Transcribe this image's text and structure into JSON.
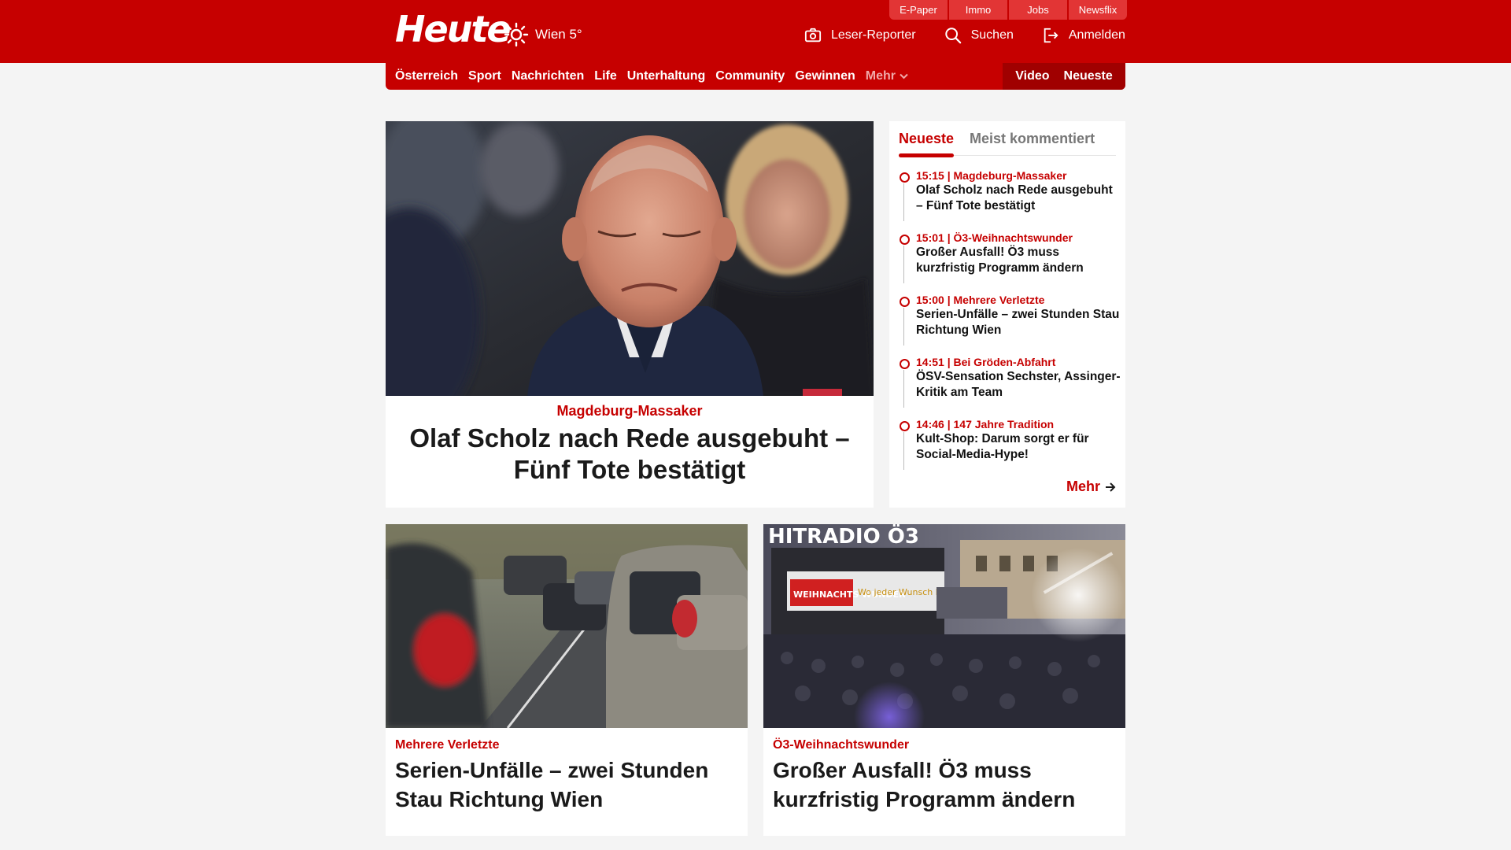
{
  "header": {
    "logo": "Heute",
    "weather": {
      "icon": "sun-icon",
      "text": "Wien 5°"
    },
    "service_tabs": [
      "E-Paper",
      "Immo",
      "Jobs",
      "Newsflix"
    ],
    "actions": [
      {
        "label": "Leser-Reporter",
        "icon": "camera-icon"
      },
      {
        "label": "Suchen",
        "icon": "search-icon"
      },
      {
        "label": "Anmelden",
        "icon": "login-icon"
      }
    ]
  },
  "nav": {
    "items": [
      "Österreich",
      "Sport",
      "Nachrichten",
      "Life",
      "Unterhaltung",
      "Community",
      "Gewinnen"
    ],
    "more": "Mehr",
    "right": [
      "Video",
      "Neueste"
    ]
  },
  "lead": {
    "kicker": "Magdeburg-Massaker",
    "title": "Olaf Scholz nach Rede ausgebuht – Fünf Tote bestätigt"
  },
  "sidebar": {
    "tabs": [
      "Neueste",
      "Meist kommentiert"
    ],
    "items": [
      {
        "meta": "15:15 | Magdeburg-Massaker",
        "title": "Olaf Scholz nach Rede ausgebuht – Fünf Tote bestätigt"
      },
      {
        "meta": "15:01 | Ö3-Weihnachtswunder",
        "title": "Großer Ausfall! Ö3 muss kurzfristig Programm ändern"
      },
      {
        "meta": "15:00 | Mehrere Verletzte",
        "title": "Serien-Unfälle – zwei Stunden Stau Richtung Wien"
      },
      {
        "meta": "14:51 | Bei Gröden-Abfahrt",
        "title": "ÖSV-Sensation Sechster, Assinger-Kritik am Team"
      },
      {
        "meta": "14:46 | 147 Jahre Tradition",
        "title": "Kult-Shop: Darum sorgt er für Social-Media-Hype!"
      }
    ],
    "more": "Mehr"
  },
  "cards": [
    {
      "kicker": "Mehrere Verletzte",
      "title": "Serien-Unfälle – zwei Stunden Stau Richtung Wien"
    },
    {
      "kicker": "Ö3-Weihnachtswunder",
      "title": "Großer Ausfall! Ö3 muss kurzfristig Programm ändern"
    }
  ],
  "image_text": {
    "banner": "HITRADIO Ö3",
    "sign_left": "WEIHNACHTS WUNDER",
    "sign_right": "Wo jeder Wunsch hilft!"
  },
  "colors": {
    "brand_red": "#c60000",
    "nav_dark_red": "#a00000",
    "tab_red": "#e23535"
  }
}
